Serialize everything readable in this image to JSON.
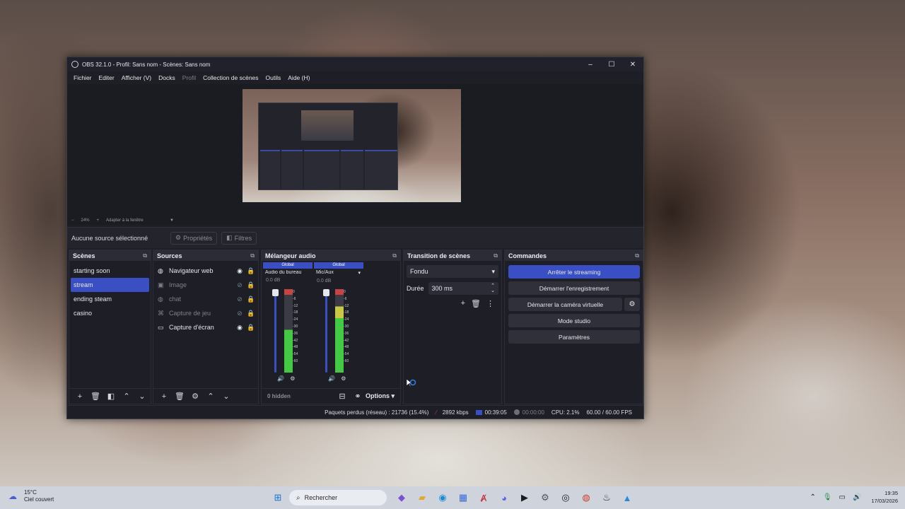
{
  "window": {
    "title": "OBS 32.1.0 - Profil: Sans nom - Scènes: Sans nom",
    "minimize": "–",
    "maximize": "☐",
    "close": "✕"
  },
  "menu": [
    "Fichier",
    "Editer",
    "Afficher (V)",
    "Docks",
    "Profil",
    "Collection de scènes",
    "Outils",
    "Aide (H)"
  ],
  "zoom_bar": {
    "minus": "−",
    "zoom": "24%",
    "plus": "+",
    "fit": "Adapter à la fenêtre",
    "arrow": "▼"
  },
  "source_toolbar": {
    "no_source": "Aucune source sélectionné",
    "properties": "Propriétés",
    "filters": "Filtres"
  },
  "scenes": {
    "title": "Scènes",
    "items": [
      "starting soon",
      "stream",
      "ending steam",
      "casino"
    ],
    "active_index": 1
  },
  "sources": {
    "title": "Sources",
    "items": [
      {
        "label": "Navigateur web",
        "icon": "globe-icon",
        "visible": true
      },
      {
        "label": "Image",
        "icon": "image-icon",
        "visible": false
      },
      {
        "label": "chat",
        "icon": "globe-icon",
        "visible": false
      },
      {
        "label": "Capture de jeu",
        "icon": "gamepad-icon",
        "visible": false
      },
      {
        "label": "Capture d'écran",
        "icon": "monitor-icon",
        "visible": true
      }
    ]
  },
  "mixer": {
    "title": "Mélangeur audio",
    "channels": [
      {
        "tag": "Global",
        "name": "Audio du bureau",
        "db": "0.0 dB",
        "level": 0.55
      },
      {
        "tag": "Global",
        "name": "Mic/Aux",
        "db": "0.0 dB",
        "level": 0.85
      }
    ],
    "scale": [
      "0",
      "-6",
      "-12",
      "-18",
      "-24",
      "-30",
      "-36",
      "-42",
      "-48",
      "-54",
      "-60"
    ],
    "hidden": "0 hidden",
    "options": "Options"
  },
  "transitions": {
    "title": "Transition de scènes",
    "selected": "Fondu",
    "duration_label": "Durée",
    "duration_value": "300 ms"
  },
  "controls": {
    "title": "Commandes",
    "stop_streaming": "Arrêter le streaming",
    "start_recording": "Démarrer l'enregistrement",
    "start_virtualcam": "Démarrer la caméra virtuelle",
    "studio_mode": "Mode studio",
    "settings": "Paramètres"
  },
  "status": {
    "dropped": "Paquets perdus (réseau) : 21736 (15.4%)",
    "bitrate": "2892 kbps",
    "stream_time": "00:39:05",
    "rec_time": "00:00:00",
    "cpu": "CPU: 2.1%",
    "fps": "60.00 / 60.00 FPS"
  },
  "taskbar": {
    "weather_temp": "15°C",
    "weather_desc": "Ciel couvert",
    "search_placeholder": "Rechercher",
    "time": "19:35",
    "date": "17/03/2026"
  },
  "colors": {
    "accent": "#3b4fc4",
    "meter_green": "#43c943",
    "meter_yellow": "#c9c943",
    "meter_red": "#c94343"
  }
}
